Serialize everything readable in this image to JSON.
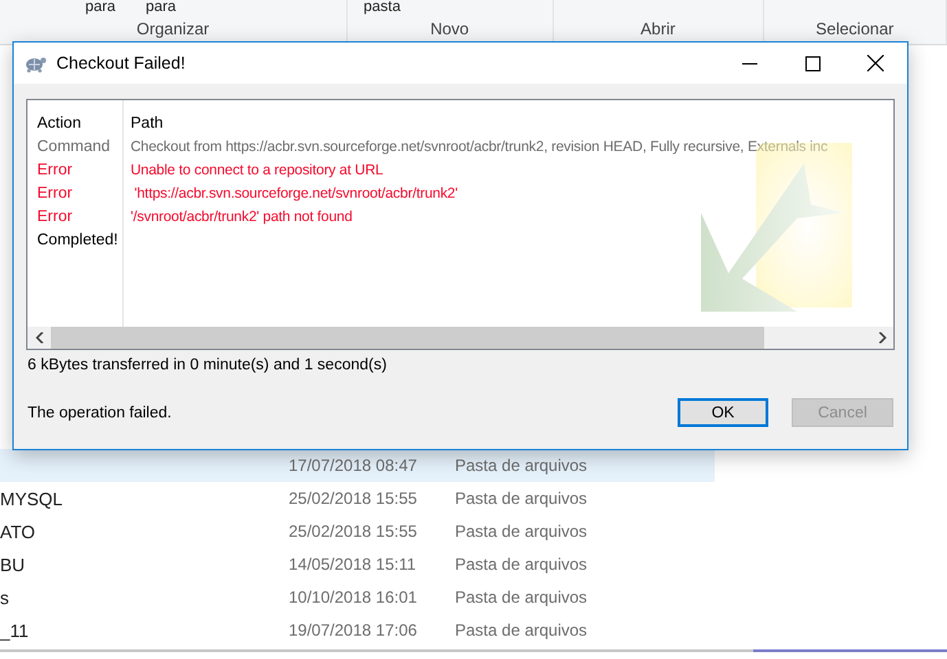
{
  "explorer": {
    "ribbon_fragments": [
      "para",
      "para",
      "pasta"
    ],
    "ribbon_groups": [
      "Organizar",
      "Novo",
      "Abrir",
      "Selecionar"
    ],
    "files": [
      {
        "date": "17/07/2018 08:47",
        "type": "Pasta de arquivos",
        "selected": true
      },
      {
        "name": "MYSQL",
        "date": "25/02/2018 15:55",
        "type": "Pasta de arquivos",
        "selected": false
      },
      {
        "name": "ATO",
        "date": "25/02/2018 15:55",
        "type": "Pasta de arquivos",
        "selected": false
      },
      {
        "name": "BU",
        "date": "14/05/2018 15:11",
        "type": "Pasta de arquivos",
        "selected": false
      },
      {
        "name": "s",
        "date": "10/10/2018 16:01",
        "type": "Pasta de arquivos",
        "selected": false
      },
      {
        "name": "_11",
        "date": "19/07/2018 17:06",
        "type": "Pasta de arquivos",
        "selected": false
      }
    ]
  },
  "dialog": {
    "title": "Checkout Failed!",
    "columns": [
      "Action",
      "Path"
    ],
    "rows": [
      {
        "kind": "command",
        "action": "Command",
        "path": "Checkout from https://acbr.svn.sourceforge.net/svnroot/acbr/trunk2, revision HEAD, Fully recursive, Externals inc"
      },
      {
        "kind": "error",
        "action": "Error",
        "path": "Unable to connect to a repository at URL"
      },
      {
        "kind": "error",
        "action": "Error",
        "path": " 'https://acbr.svn.sourceforge.net/svnroot/acbr/trunk2'"
      },
      {
        "kind": "error",
        "action": "Error",
        "path": "'/svnroot/acbr/trunk2' path not found"
      },
      {
        "kind": "done",
        "action": "Completed!"
      }
    ],
    "transfer": "6 kBytes transferred in 0 minute(s) and 1 second(s)",
    "status": "The operation failed.",
    "buttons": [
      {
        "label": "OK",
        "default": true,
        "disabled": false
      },
      {
        "label": "Cancel",
        "default": false,
        "disabled": true
      }
    ]
  }
}
